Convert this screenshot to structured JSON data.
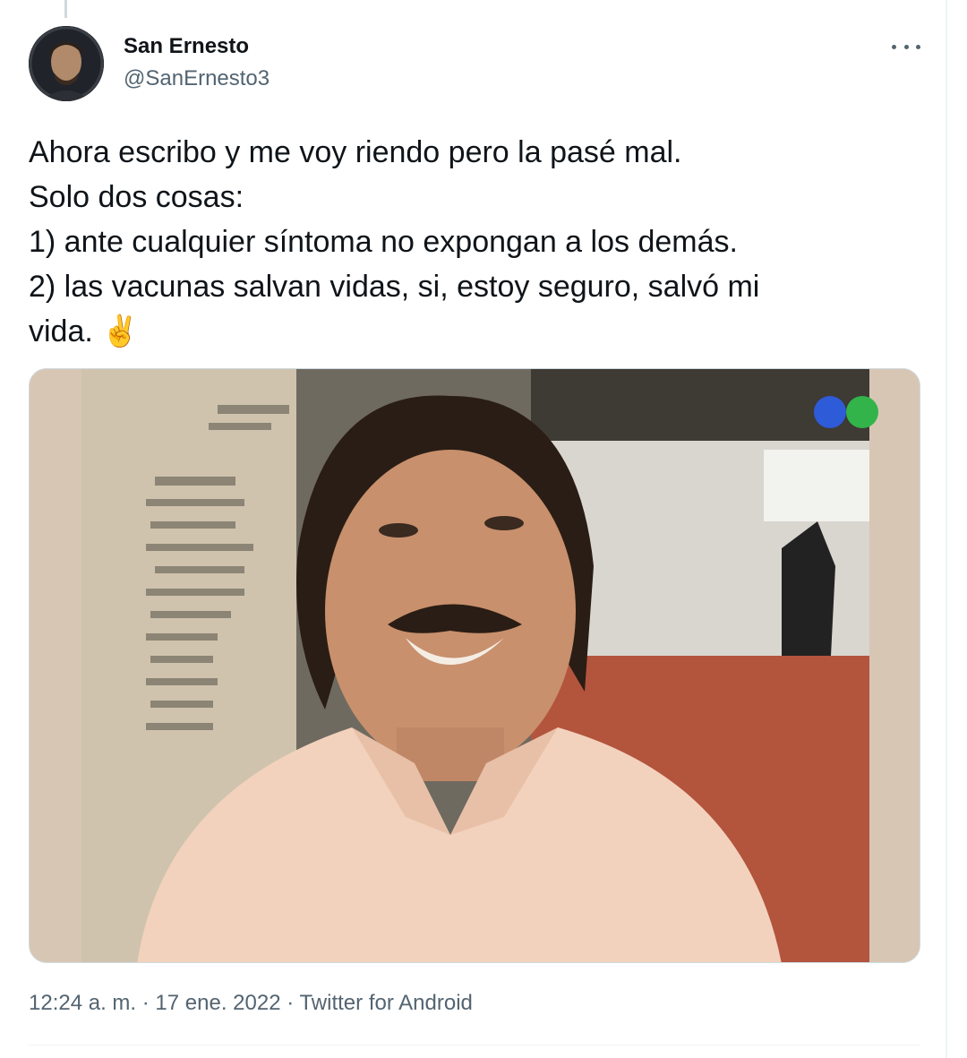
{
  "tweet": {
    "author_name": "San Ernesto",
    "author_handle": "@SanErnesto3",
    "text_lines": [
      "Ahora escribo y me voy riendo pero la pasé mal.",
      "Solo dos cosas:",
      "1) ante cualquier síntoma no expongan a los demás.",
      "2) las vacunas salvan vidas, si, estoy seguro, salvó mi",
      "vida. ✌️"
    ],
    "time": "12:24 a. m.",
    "date": "17 ene. 2022",
    "source": "Twitter for Android",
    "separator": "·"
  },
  "icons": {
    "more": "more-horizontal-icon",
    "avatar": "avatar-photo"
  },
  "colors": {
    "text": "#0f1419",
    "secondary": "#536471",
    "border": "#cfd9de"
  }
}
